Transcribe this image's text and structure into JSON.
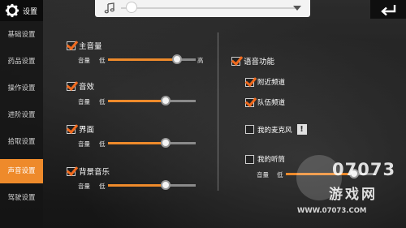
{
  "sidebar": {
    "title": "设置",
    "items": [
      {
        "label": "基础设置"
      },
      {
        "label": "药品设置"
      },
      {
        "label": "操作设置"
      },
      {
        "label": "进阶设置"
      },
      {
        "label": "拾取设置"
      },
      {
        "label": "声音设置"
      },
      {
        "label": "驾驶设置"
      }
    ]
  },
  "player": {
    "progress": 0.03
  },
  "left": {
    "main_volume": {
      "label": "主音量",
      "checked": true,
      "sub": "音量",
      "low": "低",
      "high": "高",
      "value": 0.79
    },
    "sound_effect": {
      "label": "音效",
      "checked": true,
      "sub": "音量",
      "low": "低",
      "value": 0.66
    },
    "interface": {
      "label": "界面",
      "checked": true,
      "sub": "音量",
      "low": "低",
      "value": 0.66
    },
    "bgm": {
      "label": "背景音乐",
      "checked": true,
      "sub": "音量",
      "low": "低",
      "value": 0.66
    }
  },
  "right": {
    "voice": {
      "label": "语音功能",
      "checked": true
    },
    "nearby": {
      "label": "附近频道",
      "checked": true
    },
    "team": {
      "label": "队伍频道",
      "checked": true
    },
    "mic": {
      "label": "我的麦克风",
      "checked": false,
      "warn": "!"
    },
    "earpiece": {
      "label": "我的听筒",
      "checked": false,
      "sub": "音量",
      "low": "低",
      "value": 0.76
    }
  },
  "watermark": {
    "brand": "07073",
    "name": "游戏网",
    "url": "WWW.07073.COM"
  },
  "colors": {
    "accent": "#ee8a2b",
    "check": "#f06a1e"
  }
}
